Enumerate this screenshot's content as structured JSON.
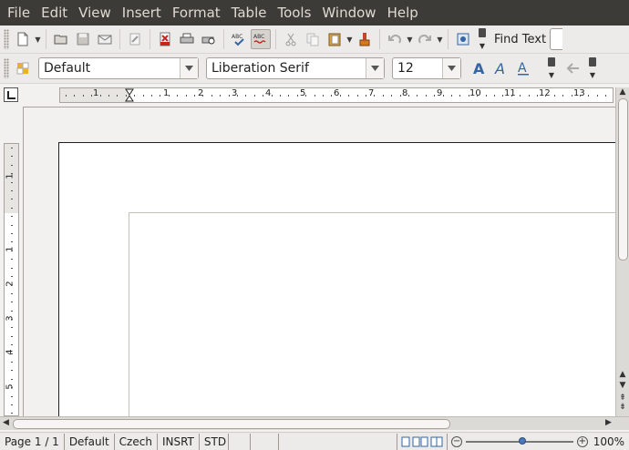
{
  "menu": [
    {
      "label": "File",
      "accel": "F",
      "rest": "ile"
    },
    {
      "label": "Edit",
      "accel": "E",
      "rest": "dit"
    },
    {
      "label": "View",
      "accel": "V",
      "rest": "iew"
    },
    {
      "label": "Insert",
      "accel": "I",
      "rest": "nsert"
    },
    {
      "label": "Format",
      "accel": "F",
      "pre": "Fo",
      "accel2": "r",
      "rest": "mat"
    },
    {
      "label": "Table",
      "accel": "T",
      "rest": "able"
    },
    {
      "label": "Tools",
      "accel": "T",
      "rest": "ools"
    },
    {
      "label": "Window",
      "accel": "W",
      "rest": "indow"
    },
    {
      "label": "Help",
      "accel": "H",
      "rest": "elp"
    }
  ],
  "toolbar": {
    "find_text_label": "Find Text",
    "paragraph_style": "Default",
    "font_name": "Liberation Serif",
    "font_size": "12"
  },
  "ruler": {
    "h_numbers": [
      "1",
      "1",
      "2",
      "3",
      "4",
      "5",
      "6",
      "7",
      "8",
      "9",
      "10",
      "11",
      "12",
      "13"
    ],
    "v_numbers": [
      "1",
      "1",
      "2",
      "3",
      "4",
      "5"
    ]
  },
  "status": {
    "page": "Page 1 / 1",
    "style": "Default",
    "language": "Czech",
    "insert_mode": "INSRT",
    "selection_mode": "STD",
    "zoom": "100%"
  },
  "colors": {
    "menubar_bg": "#3c3b37",
    "menubar_text": "#dfdbd2",
    "accent_blue": "#3465a4"
  }
}
